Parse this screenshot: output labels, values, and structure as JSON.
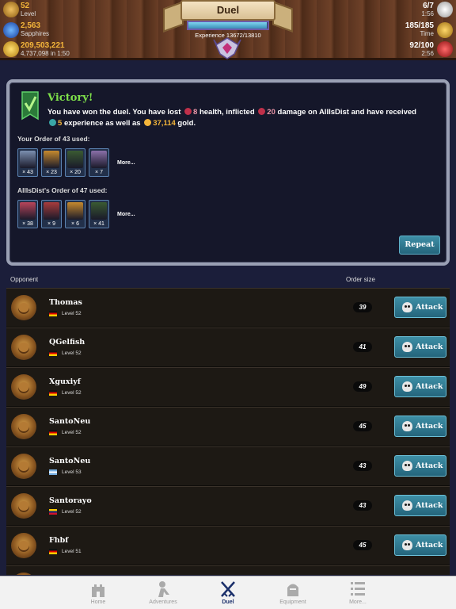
{
  "topbar": {
    "level_value": "52",
    "level_label": "Level",
    "sapphires_value": "2,563",
    "sapphires_label": "Sapphires",
    "gold_value": "209,503,221",
    "gold_sub": "4,737,098 in 1:50",
    "title": "Duel",
    "experience_text": "Experience 13672/13810",
    "xp_fraction": 0.99,
    "duels_value": "6/7",
    "duels_timer": "1:56",
    "time_value": "185/185",
    "time_label": "Time",
    "health_value": "92/100",
    "health_timer": "2:56"
  },
  "result": {
    "title": "Victory!",
    "text_1": "You have won the duel. You have lost",
    "lost_health": "8",
    "text_2": "health, inflicted",
    "inflicted": "20",
    "text_3": "damage on AllIsDist and have received",
    "exp_gain": "5",
    "text_4": "experience as well as",
    "gold_gain": "37,114",
    "text_5": "gold.",
    "your_order_label": "Your Order of 43 used:",
    "your_cards": [
      {
        "count": "× 43",
        "icon": "claw-icon",
        "color": "#7b8fb0"
      },
      {
        "count": "× 23",
        "icon": "boots-icon",
        "color": "#c68a2e"
      },
      {
        "count": "× 20",
        "icon": "hood-icon",
        "color": "#3a5a32"
      },
      {
        "count": "× 7",
        "icon": "wolf-icon",
        "color": "#8a6fa8"
      }
    ],
    "enemy_order_label": "AllIsDist's Order of 47 used:",
    "enemy_cards": [
      {
        "count": "× 38",
        "icon": "axe-icon",
        "color": "#b8455a"
      },
      {
        "count": "× 9",
        "icon": "sword-icon",
        "color": "#a83c3c"
      },
      {
        "count": "× 6",
        "icon": "boots-icon",
        "color": "#c68a2e"
      },
      {
        "count": "× 41",
        "icon": "hood-icon",
        "color": "#3a5a32"
      }
    ],
    "more_label": "More...",
    "repeat_label": "Repeat"
  },
  "list_header": {
    "opponent": "Opponent",
    "order_size": "Order size"
  },
  "opponents": [
    {
      "name": "Thomas",
      "level": "Level 52",
      "order": "39",
      "flag": "de"
    },
    {
      "name": "QGelfish",
      "level": "Level 52",
      "order": "41",
      "flag": "de"
    },
    {
      "name": "Xguxiyf",
      "level": "Level 52",
      "order": "49",
      "flag": "de"
    },
    {
      "name": "SantoNeu",
      "level": "Level 52",
      "order": "45",
      "flag": "de"
    },
    {
      "name": "SantoNeu",
      "level": "Level 53",
      "order": "43",
      "flag": "ar"
    },
    {
      "name": "Santorayo",
      "level": "Level 52",
      "order": "43",
      "flag": "ve"
    },
    {
      "name": "Fhbf",
      "level": "Level 51",
      "order": "45",
      "flag": "de"
    }
  ],
  "attack_label": "Attack",
  "tabs": [
    {
      "label": "Home",
      "icon": "castle-icon"
    },
    {
      "label": "Adventures",
      "icon": "adventurer-icon"
    },
    {
      "label": "Duel",
      "icon": "crossed-swords-icon"
    },
    {
      "label": "Equipment",
      "icon": "knight-helmet-icon"
    },
    {
      "label": "More...",
      "icon": "list-icon"
    }
  ],
  "active_tab": "Duel",
  "colors": {
    "accent_teal": "#2f7a92",
    "victory_green": "#7ee04a",
    "gold": "#f3b53a"
  }
}
